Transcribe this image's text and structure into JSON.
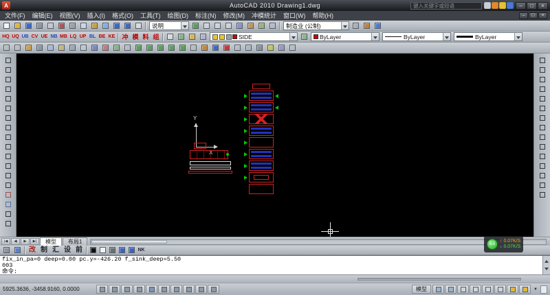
{
  "colors": {
    "accent_red": "#d22222",
    "strip_blue": "#2233bb",
    "marker_green": "#00cc00",
    "layer_red": "#cc0000",
    "canvas_bg": "#000000"
  },
  "titlebar": {
    "logo_letter": "A",
    "title": "AutoCAD 2010  Drawing1.dwg",
    "search": {
      "placeholder": "键入关键字或短语"
    },
    "info_icons": [
      {
        "name": "search-go-icon",
        "color": "#c9cfd6"
      },
      {
        "name": "communication-center-icon",
        "color": "#e08a2d"
      },
      {
        "name": "favorites-icon",
        "color": "#e6c235"
      },
      {
        "name": "help-icon",
        "color": "#4a7ad4"
      }
    ],
    "window_buttons": [
      {
        "name": "minimize-button",
        "label": "–"
      },
      {
        "name": "restore-button",
        "label": "□"
      },
      {
        "name": "close-button",
        "label": "×"
      }
    ]
  },
  "menubar": {
    "items": [
      {
        "name": "menu-file",
        "label": "文件(F)"
      },
      {
        "name": "menu-edit",
        "label": "编辑(E)"
      },
      {
        "name": "menu-view",
        "label": "视图(V)"
      },
      {
        "name": "menu-insert",
        "label": "插入(I)"
      },
      {
        "name": "menu-format",
        "label": "格式(O)"
      },
      {
        "name": "menu-tools",
        "label": "工具(T)"
      },
      {
        "name": "menu-draw",
        "label": "绘图(D)"
      },
      {
        "name": "menu-dimension",
        "label": "标注(N)"
      },
      {
        "name": "menu-modify",
        "label": "修改(M)"
      },
      {
        "name": "menu-die-stats",
        "label": "冲模统计"
      },
      {
        "name": "menu-window",
        "label": "窗口(W)"
      },
      {
        "name": "menu-help",
        "label": "帮助(H)"
      }
    ],
    "mdi_buttons": [
      {
        "name": "mdi-minimize-button",
        "label": "–"
      },
      {
        "name": "mdi-restore-button",
        "label": "□"
      },
      {
        "name": "mdi-close-button",
        "label": "×"
      }
    ]
  },
  "toolbars": {
    "row1": {
      "icons_a": [
        {
          "name": "qnew-icon",
          "color": "#f2f4f6"
        },
        {
          "name": "open-icon",
          "color": "#e3b33c"
        },
        {
          "name": "save-icon",
          "color": "#3a68c8"
        },
        {
          "name": "plot-icon",
          "color": "#8d949b"
        },
        {
          "name": "plot-preview-icon",
          "color": "#c3c9cf"
        },
        {
          "name": "publish-icon",
          "color": "#b05656"
        },
        {
          "name": "cut-icon",
          "color": "#9aa1a8"
        },
        {
          "name": "copy-icon",
          "color": "#ccd2e6"
        },
        {
          "name": "paste-icon",
          "color": "#c7a23e"
        },
        {
          "name": "match-properties-icon",
          "color": "#7fb0e0"
        },
        {
          "name": "undo-icon",
          "color": "#3a68c8"
        },
        {
          "name": "redo-icon",
          "color": "#3a68c8"
        },
        {
          "name": "find-icon",
          "color": "#d6dade"
        }
      ],
      "combo1": {
        "value": "说明"
      },
      "icons_b": [
        {
          "name": "pan-icon",
          "color": "#57a257"
        },
        {
          "name": "zoom-realtime-icon",
          "color": "#ccd2d8"
        },
        {
          "name": "zoom-window-icon",
          "color": "#ccd2d8"
        },
        {
          "name": "zoom-previous-icon",
          "color": "#ccd2d8"
        },
        {
          "name": "properties-icon",
          "color": "#8894c6"
        },
        {
          "name": "designcenter-icon",
          "color": "#c69458"
        },
        {
          "name": "tool-palettes-icon",
          "color": "#96b478"
        },
        {
          "name": "quickcalc-icon",
          "color": "#b4b9c8"
        }
      ],
      "combo2": {
        "value": "制造业 (公制)"
      },
      "icons_c": [
        {
          "name": "sheet-set-manager-icon",
          "color": "#a8aeb5"
        },
        {
          "name": "markup-set-manager-icon",
          "color": "#c08040"
        },
        {
          "name": "help-topic-icon",
          "color": "#4a7ad4"
        }
      ]
    },
    "row2": {
      "letter_icons": [
        {
          "name": "die-tool-hq-icon",
          "label": "HQ",
          "color": "#c00000"
        },
        {
          "name": "die-tool-uq-icon",
          "label": "UQ",
          "color": "#c00000"
        },
        {
          "name": "die-tool-ub-icon",
          "label": "UB",
          "color": "#2244bb"
        },
        {
          "name": "die-tool-cv-icon",
          "label": "CV",
          "color": "#c00000"
        },
        {
          "name": "die-tool-ue-icon",
          "label": "UE",
          "color": "#c00000"
        },
        {
          "name": "die-tool-nb-icon",
          "label": "NB",
          "color": "#2244bb"
        },
        {
          "name": "die-tool-mb-icon",
          "label": "MB",
          "color": "#c00000"
        },
        {
          "name": "die-tool-lq-icon",
          "label": "LQ",
          "color": "#c00000"
        },
        {
          "name": "die-tool-up-icon",
          "label": "UP",
          "color": "#c00000"
        },
        {
          "name": "die-tool-bl-icon",
          "label": "BL",
          "color": "#2244bb"
        },
        {
          "name": "die-tool-be-icon",
          "label": "BE",
          "color": "#c00000"
        },
        {
          "name": "die-tool-ke-icon",
          "label": "KE",
          "color": "#c00000"
        }
      ],
      "cn_icons": [
        {
          "name": "die-tool-punch-icon",
          "label": "冲",
          "color": "#c00000"
        },
        {
          "name": "die-tool-mold-icon",
          "label": "模",
          "color": "#c00000"
        },
        {
          "name": "die-tool-material-icon",
          "label": "料",
          "color": "#c00000"
        },
        {
          "name": "die-tool-group-icon",
          "label": "组",
          "color": "#c00000"
        }
      ],
      "layer_tools": [
        {
          "name": "layer-properties-manager-icon",
          "color": "#d8dce0"
        },
        {
          "name": "layer-states-manager-icon",
          "color": "#86b286"
        },
        {
          "name": "layer-previous-icon",
          "color": "#d8b658"
        },
        {
          "name": "layer-isolate-icon",
          "color": "#b2b2d6"
        }
      ],
      "layer_combo": {
        "status_icons": [
          {
            "name": "layer-on-icon",
            "color": "#e6c63a"
          },
          {
            "name": "layer-freeze-icon",
            "color": "#e6c63a"
          },
          {
            "name": "layer-lock-icon",
            "color": "#9aa1a8"
          }
        ],
        "swatch": "#cc0000",
        "value": "SIDE"
      },
      "mid_icons": [
        {
          "name": "make-object-layer-current-icon",
          "color": "#8db48d"
        }
      ],
      "color_combo": {
        "swatch": "#cc0000",
        "value": "ByLayer"
      },
      "linetype_combo": {
        "value": "ByLayer"
      },
      "lineweight_combo": {
        "value": "ByLayer"
      }
    },
    "row3": {
      "icons": [
        {
          "name": "dim-style-icon",
          "color": "#b6bcc2"
        },
        {
          "name": "text-style-icon",
          "color": "#b6bcc2"
        },
        {
          "name": "table-style-icon",
          "color": "#d0a040"
        },
        {
          "name": "mleader-style-icon",
          "color": "#8898a8"
        },
        {
          "name": "update-field-icon",
          "color": "#a8b8d8"
        },
        {
          "name": "block-editor-icon",
          "color": "#c6b678"
        },
        {
          "name": "xref-icon",
          "color": "#98a8b8"
        },
        {
          "name": "image-attach-icon",
          "color": "#b8c8d8"
        },
        {
          "name": "layout-icon",
          "color": "#7888c8"
        },
        {
          "name": "viewport-icon",
          "color": "#c87878"
        },
        {
          "name": "named-views-icon",
          "color": "#88b488"
        },
        {
          "name": "orbit-icon",
          "color": "#b6bcc2"
        },
        {
          "name": "osnap-endpoint-icon",
          "color": "#56a256"
        },
        {
          "name": "osnap-midpoint-icon",
          "color": "#56a256"
        },
        {
          "name": "osnap-center-icon",
          "color": "#56a256"
        },
        {
          "name": "osnap-node-icon",
          "color": "#56a256"
        },
        {
          "name": "osnap-quadrant-icon",
          "color": "#56a256"
        },
        {
          "name": "ucs-icon",
          "color": "#b6bcc2"
        },
        {
          "name": "ucs-world-icon",
          "color": "#c68838"
        },
        {
          "name": "measure-distance-icon",
          "color": "#3868c8"
        },
        {
          "name": "area-icon",
          "color": "#c83838"
        },
        {
          "name": "list-icon",
          "color": "#b6bcc2"
        },
        {
          "name": "id-point-icon",
          "color": "#a8b8c8"
        },
        {
          "name": "group-icon",
          "color": "#8a9098"
        },
        {
          "name": "draw-order-icon",
          "color": "#c6c658"
        },
        {
          "name": "regen-icon",
          "color": "#9898c6"
        },
        {
          "name": "redraw-icon",
          "color": "#b6bcc2"
        }
      ]
    }
  },
  "left_toolbar": {
    "icons": [
      {
        "name": "line-icon",
        "color": "#30353a"
      },
      {
        "name": "construction-line-icon",
        "color": "#30353a"
      },
      {
        "name": "polyline-icon",
        "color": "#30353a"
      },
      {
        "name": "polygon-icon",
        "color": "#30353a"
      },
      {
        "name": "rectangle-icon",
        "color": "#30353a"
      },
      {
        "name": "arc-icon",
        "color": "#30353a"
      },
      {
        "name": "circle-icon",
        "color": "#30353a"
      },
      {
        "name": "revision-cloud-icon",
        "color": "#30353a"
      },
      {
        "name": "spline-icon",
        "color": "#30353a"
      },
      {
        "name": "ellipse-icon",
        "color": "#30353a"
      },
      {
        "name": "ellipse-arc-icon",
        "color": "#30353a"
      },
      {
        "name": "insert-block-icon",
        "color": "#30353a"
      },
      {
        "name": "make-block-icon",
        "color": "#30353a"
      },
      {
        "name": "point-icon",
        "color": "#30353a"
      },
      {
        "name": "hatch-icon",
        "color": "#a05050"
      },
      {
        "name": "gradient-icon",
        "color": "#5070a0"
      },
      {
        "name": "region-icon",
        "color": "#30353a"
      },
      {
        "name": "multiline-text-icon",
        "color": "#30353a"
      }
    ]
  },
  "right_toolbar": {
    "icons": [
      {
        "name": "erase-icon",
        "color": "#30353a"
      },
      {
        "name": "copy-object-icon",
        "color": "#30353a"
      },
      {
        "name": "mirror-icon",
        "color": "#30353a"
      },
      {
        "name": "offset-icon",
        "color": "#30353a"
      },
      {
        "name": "array-icon",
        "color": "#30353a"
      },
      {
        "name": "move-icon",
        "color": "#30353a"
      },
      {
        "name": "rotate-icon",
        "color": "#30353a"
      },
      {
        "name": "scale-icon",
        "color": "#30353a"
      },
      {
        "name": "stretch-icon",
        "color": "#30353a"
      },
      {
        "name": "trim-icon",
        "color": "#30353a"
      },
      {
        "name": "extend-icon",
        "color": "#30353a"
      },
      {
        "name": "break-icon",
        "color": "#30353a"
      },
      {
        "name": "chamfer-icon",
        "color": "#30353a"
      },
      {
        "name": "fillet-icon",
        "color": "#30353a"
      },
      {
        "name": "explode-icon",
        "color": "#30353a"
      }
    ]
  },
  "canvas": {
    "ucs": {
      "y_label": "Y",
      "x_label": "X"
    },
    "strip": {
      "cells": [
        {
          "name": "strip-cell",
          "cls": "small"
        },
        {
          "name": "strip-cell",
          "cls": "blue aL aR"
        },
        {
          "name": "strip-cell",
          "cls": "blue aL aR"
        },
        {
          "name": "strip-cell",
          "cls": "xmark aL"
        },
        {
          "name": "strip-cell",
          "cls": "blue aL"
        },
        {
          "name": "strip-cell",
          "cls": "aL"
        },
        {
          "name": "strip-cell",
          "cls": "blue aL"
        },
        {
          "name": "strip-cell",
          "cls": "blue aL"
        },
        {
          "name": "strip-cell",
          "cls": "inner aL"
        },
        {
          "name": "strip-cell",
          "cls": ""
        }
      ]
    }
  },
  "tabrow": {
    "arrows": [
      {
        "name": "tab-first-button",
        "label": "|◀"
      },
      {
        "name": "tab-prev-button",
        "label": "◀"
      },
      {
        "name": "tab-next-button",
        "label": "▶"
      },
      {
        "name": "tab-last-button",
        "label": "▶|"
      }
    ],
    "tabs": [
      {
        "name": "tab-model",
        "label": "模型",
        "cls": "active"
      },
      {
        "name": "tab-layout1",
        "label": "布局1"
      }
    ]
  },
  "tb4": {
    "icons_a": [
      {
        "name": "plugin-tool-icon",
        "color": "#8d949b"
      },
      {
        "name": "plugin-settings-icon",
        "color": "#5a82c8"
      }
    ],
    "labels": [
      {
        "name": "die-tool-modify-button",
        "label": "改",
        "color": "#b02020"
      },
      {
        "name": "die-tool-make-button",
        "label": "制",
        "color": "#23242a"
      },
      {
        "name": "die-tool-collect-button",
        "label": "汇",
        "color": "#23242a"
      },
      {
        "name": "die-tool-setup-button",
        "label": "设",
        "color": "#23242a"
      },
      {
        "name": "die-tool-front-button",
        "label": "前",
        "color": "#23242a"
      }
    ],
    "icons_b": [
      {
        "name": "swatch-black-icon",
        "color": "#101010"
      },
      {
        "name": "swatch-white-icon",
        "color": "#f0f0f0"
      },
      {
        "name": "swatch-gray-icon",
        "color": "#6a7076"
      },
      {
        "name": "swatch-blue1-icon",
        "color": "#3a62c8"
      },
      {
        "name": "swatch-blue2-icon",
        "color": "#3a62c8"
      },
      {
        "name": "die-tool-nk-button",
        "label": "NK",
        "color": "#23242a"
      }
    ]
  },
  "cmd": {
    "lines": [
      {
        "name": "command-history-line-1",
        "label": "fix_in_pa=0 deep=0.00 pc.y=-426.20 f_sink_deep=5.50"
      },
      {
        "name": "command-history-line-2",
        "label": "003"
      },
      {
        "name": "command-prompt-line",
        "label": "命令:"
      }
    ]
  },
  "status": {
    "coords": "5925.3636, -3458.9160, 0.0000",
    "toggles": [
      {
        "name": "snap-toggle",
        "color": "#8d99a5"
      },
      {
        "name": "grid-toggle",
        "color": "#8d99a5"
      },
      {
        "name": "ortho-toggle",
        "color": "#8d99a5"
      },
      {
        "name": "polar-toggle",
        "color": "#8d99a5"
      },
      {
        "name": "osnap-toggle",
        "color": "#7a96b2"
      },
      {
        "name": "otrack-toggle",
        "color": "#8d99a5"
      },
      {
        "name": "ducs-toggle",
        "color": "#8d99a5"
      },
      {
        "name": "dyn-toggle",
        "color": "#8d99a5"
      },
      {
        "name": "lineweight-toggle",
        "color": "#8d99a5"
      },
      {
        "name": "quick-properties-toggle",
        "color": "#8d99a5"
      }
    ],
    "model_label": "模型",
    "right_icons": [
      {
        "name": "quick-view-layouts-icon",
        "color": "#9db3c8"
      },
      {
        "name": "quick-view-drawings-icon",
        "color": "#9db3c8"
      },
      {
        "name": "pan-status-icon",
        "color": "#cfd4d9"
      },
      {
        "name": "zoom-status-icon",
        "color": "#cfd4d9"
      },
      {
        "name": "steering-wheel-icon",
        "color": "#cfd4d9"
      },
      {
        "name": "show-motion-icon",
        "color": "#cfd4d9"
      },
      {
        "name": "annotation-scale-icon",
        "color": "#e0b93c"
      },
      {
        "name": "annotation-visibility-icon",
        "color": "#e0b93c"
      }
    ],
    "menu_arrow": "▼"
  },
  "speed_overlay": {
    "percent": "5.5",
    "up": "↑ 0.07K/S",
    "down": "↓ 0.07K/S"
  }
}
